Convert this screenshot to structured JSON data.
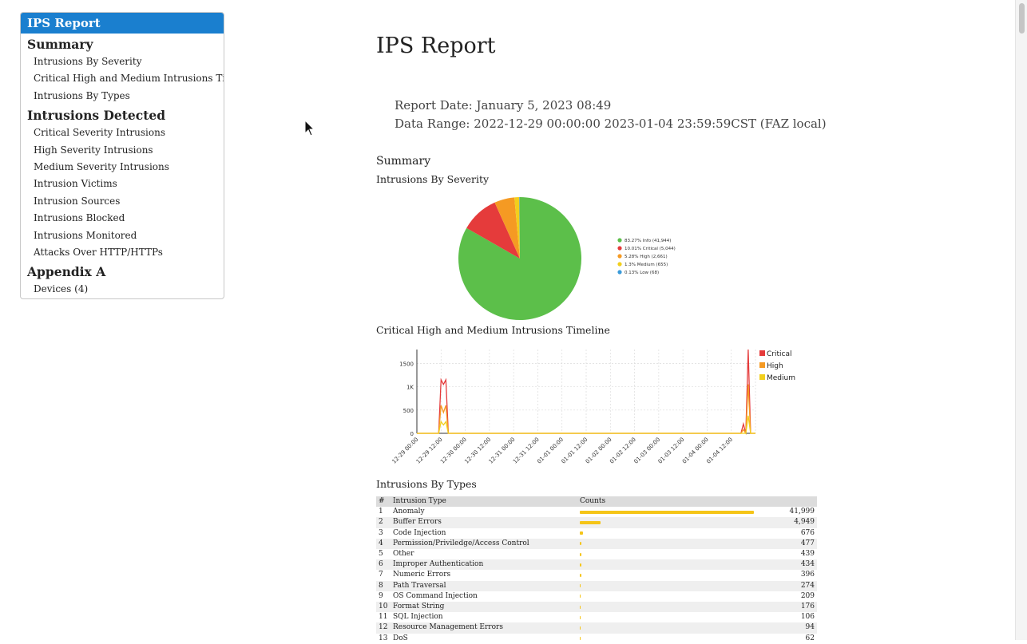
{
  "sidebar": {
    "title": "IPS Report",
    "sections": [
      {
        "heading": "Summary",
        "items": [
          "Intrusions By Severity",
          "Critical High and Medium Intrusions Timeline",
          "Intrusions By Types"
        ]
      },
      {
        "heading": "Intrusions Detected",
        "items": [
          "Critical Severity Intrusions",
          "High Severity Intrusions",
          "Medium Severity Intrusions",
          "Intrusion Victims",
          "Intrusion Sources",
          "Intrusions Blocked",
          "Intrusions Monitored",
          "Attacks Over HTTP/HTTPs"
        ]
      },
      {
        "heading": "Appendix A",
        "items": [
          "Devices (4)"
        ]
      }
    ]
  },
  "report": {
    "title": "IPS Report",
    "report_date": "Report Date: January 5, 2023 08:49",
    "data_range": "Data Range: 2022-12-29 00:00:00 2023-01-04 23:59:59CST (FAZ local)",
    "summary_label": "Summary",
    "severity_label": "Intrusions By Severity",
    "timeline_label": "Critical High and Medium Intrusions Timeline",
    "types_label": "Intrusions By Types"
  },
  "colors": {
    "info": "#5cbf4a",
    "critical": "#e53b3b",
    "high": "#f59a23",
    "medium": "#f2cf1c",
    "low": "#3a9ad9",
    "bar": "#f5c518"
  },
  "chart_data": [
    {
      "type": "pie",
      "title": "Intrusions By Severity",
      "slices": [
        {
          "label": "83.27% Info (41,944)",
          "value": 41944,
          "color": "#5cbf4a"
        },
        {
          "label": "10.01% Critical (5,044)",
          "value": 5044,
          "color": "#e53b3b"
        },
        {
          "label": "5.28% High (2,661)",
          "value": 2661,
          "color": "#f59a23"
        },
        {
          "label": "1.3% Medium (655)",
          "value": 655,
          "color": "#f2cf1c"
        },
        {
          "label": "0.13% Low (68)",
          "value": 68,
          "color": "#3a9ad9"
        }
      ],
      "legend": "right"
    },
    {
      "type": "line",
      "title": "Critical High and Medium Intrusions Timeline",
      "x": [
        "12-29 00:00",
        "12-29 12:00",
        "12-30 00:00",
        "12-30 12:00",
        "12-31 00:00",
        "12-31 12:00",
        "01-01 00:00",
        "01-01 12:00",
        "01-02 00:00",
        "01-02 12:00",
        "01-03 00:00",
        "01-03 12:00",
        "01-04 00:00",
        "01-04 12:00"
      ],
      "yticks": [
        "0",
        "500",
        "1K",
        "1500"
      ],
      "ylim": [
        0,
        1800
      ],
      "grid": true,
      "legend": "right",
      "series": [
        {
          "name": "Critical",
          "color": "#e53b3b",
          "points": [
            [
              0.9,
              0
            ],
            [
              1.0,
              1150
            ],
            [
              1.1,
              1050
            ],
            [
              1.2,
              1150
            ],
            [
              1.3,
              0
            ],
            [
              13.4,
              0
            ],
            [
              13.5,
              200
            ],
            [
              13.6,
              0
            ],
            [
              13.7,
              1800
            ],
            [
              13.8,
              0
            ]
          ]
        },
        {
          "name": "High",
          "color": "#f59a23",
          "points": [
            [
              0.9,
              0
            ],
            [
              1.0,
              600
            ],
            [
              1.1,
              450
            ],
            [
              1.2,
              600
            ],
            [
              1.3,
              0
            ],
            [
              13.4,
              0
            ],
            [
              13.5,
              80
            ],
            [
              13.6,
              0
            ],
            [
              13.7,
              1050
            ],
            [
              13.8,
              0
            ]
          ]
        },
        {
          "name": "Medium",
          "color": "#f2cf1c",
          "points": [
            [
              0.9,
              0
            ],
            [
              1.0,
              250
            ],
            [
              1.1,
              180
            ],
            [
              1.2,
              250
            ],
            [
              1.3,
              0
            ],
            [
              13.6,
              0
            ],
            [
              13.7,
              380
            ],
            [
              13.8,
              0
            ]
          ]
        }
      ]
    },
    {
      "type": "table",
      "title": "Intrusions By Types",
      "columns": [
        "#",
        "Intrusion Type",
        "Counts"
      ],
      "rows": [
        {
          "rank": "1",
          "type": "Anomaly",
          "count": 41999,
          "count_label": "41,999"
        },
        {
          "rank": "2",
          "type": "Buffer Errors",
          "count": 4949,
          "count_label": "4,949"
        },
        {
          "rank": "3",
          "type": "Code Injection",
          "count": 676,
          "count_label": "676"
        },
        {
          "rank": "4",
          "type": "Permission/Priviledge/Access Control",
          "count": 477,
          "count_label": "477"
        },
        {
          "rank": "5",
          "type": "Other",
          "count": 439,
          "count_label": "439"
        },
        {
          "rank": "6",
          "type": "Improper Authentication",
          "count": 434,
          "count_label": "434"
        },
        {
          "rank": "7",
          "type": "Numeric Errors",
          "count": 396,
          "count_label": "396"
        },
        {
          "rank": "8",
          "type": "Path Traversal",
          "count": 274,
          "count_label": "274"
        },
        {
          "rank": "9",
          "type": "OS Command Injection",
          "count": 209,
          "count_label": "209"
        },
        {
          "rank": "10",
          "type": "Format String",
          "count": 176,
          "count_label": "176"
        },
        {
          "rank": "11",
          "type": "SQL Injection",
          "count": 106,
          "count_label": "106"
        },
        {
          "rank": "12",
          "type": "Resource Management Errors",
          "count": 94,
          "count_label": "94"
        },
        {
          "rank": "13",
          "type": "DoS",
          "count": 62,
          "count_label": "62"
        }
      ]
    }
  ]
}
